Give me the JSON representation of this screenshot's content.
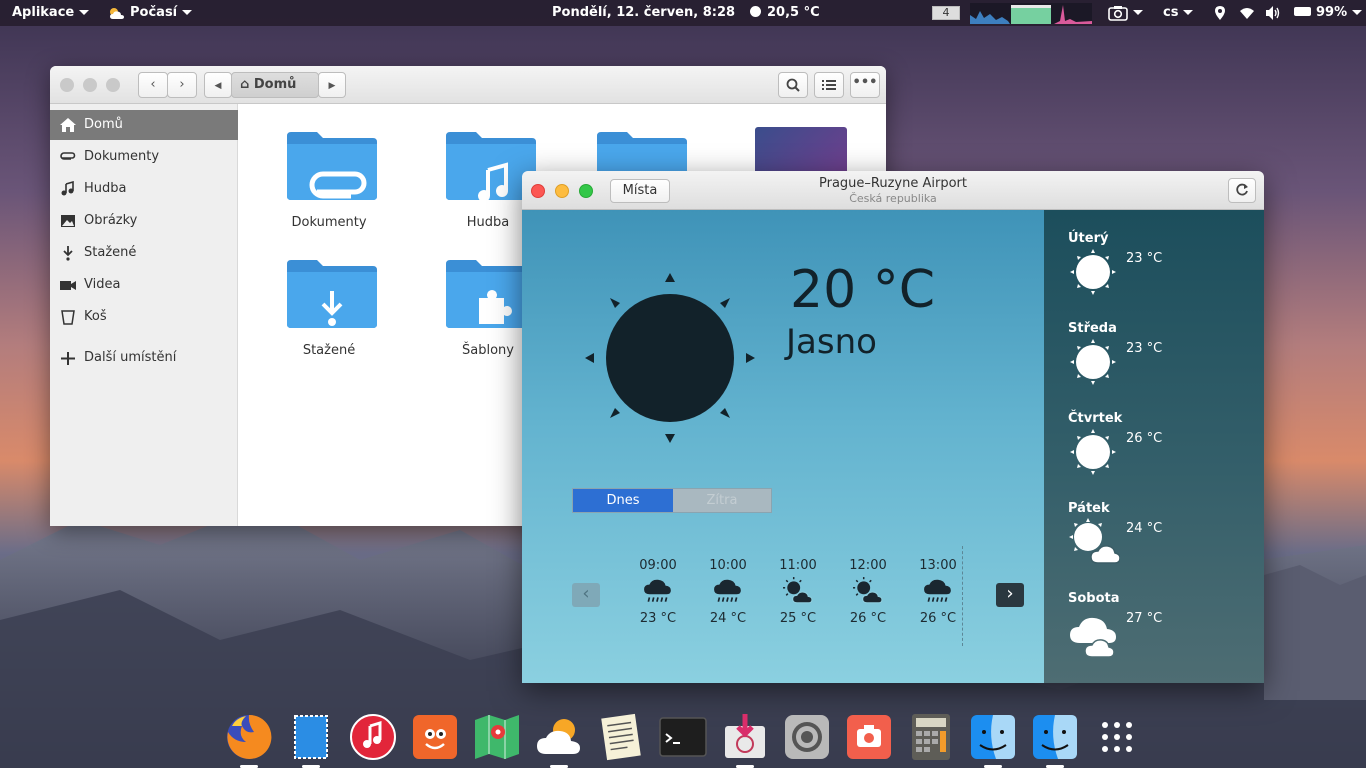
{
  "topbar": {
    "apps_label": "Aplikace",
    "weather_label": "Počasí",
    "datetime": "Pondělí, 12. červen,  8:28",
    "temperature": "20,5 °C",
    "workspace": "4",
    "language": "cs",
    "battery": "99%"
  },
  "files": {
    "location": "Domů",
    "sidebar": [
      {
        "label": "Domů",
        "icon": "home-icon"
      },
      {
        "label": "Dokumenty",
        "icon": "paperclip-icon"
      },
      {
        "label": "Hudba",
        "icon": "music-note-icon"
      },
      {
        "label": "Obrázky",
        "icon": "image-icon"
      },
      {
        "label": "Stažené",
        "icon": "download-icon"
      },
      {
        "label": "Videa",
        "icon": "video-camera-icon"
      },
      {
        "label": "Koš",
        "icon": "trash-icon"
      },
      {
        "label": "Další umístění",
        "icon": "plus-icon"
      }
    ],
    "folders": [
      {
        "label": "Dokumenty",
        "icon": "paperclip-icon"
      },
      {
        "label": "Hudba",
        "icon": "music-note-icon"
      },
      {
        "label": "Stažené",
        "icon": "download-icon"
      },
      {
        "label": "Šablony",
        "icon": "puzzle-icon"
      }
    ]
  },
  "weather": {
    "places_button": "Místa",
    "location": "Prague–Ruzyne Airport",
    "country": "Česká republika",
    "temperature": "20 °C",
    "condition": "Jasno",
    "tabs": {
      "today": "Dnes",
      "tomorrow": "Zítra"
    },
    "hourly": [
      {
        "time": "09:00",
        "temp": "23 °C",
        "icon": "rain-cloud-icon"
      },
      {
        "time": "10:00",
        "temp": "24 °C",
        "icon": "rain-cloud-icon"
      },
      {
        "time": "11:00",
        "temp": "25 °C",
        "icon": "cloud-sun-icon"
      },
      {
        "time": "12:00",
        "temp": "26 °C",
        "icon": "cloud-sun-icon"
      },
      {
        "time": "13:00",
        "temp": "26 °C",
        "icon": "rain-cloud-icon"
      }
    ],
    "daily": [
      {
        "day": "Úterý",
        "temp": "23 °C",
        "icon": "sun-icon"
      },
      {
        "day": "Středa",
        "temp": "23 °C",
        "icon": "sun-icon"
      },
      {
        "day": "Čtvrtek",
        "temp": "26 °C",
        "icon": "sun-icon"
      },
      {
        "day": "Pátek",
        "temp": "24 °C",
        "icon": "sun-cloud-icon"
      },
      {
        "day": "Sobota",
        "temp": "27 °C",
        "icon": "clouds-icon"
      }
    ]
  },
  "dock": [
    {
      "icon": "firefox-icon",
      "running": true
    },
    {
      "icon": "mail-icon",
      "running": true
    },
    {
      "icon": "music-player-icon",
      "running": false
    },
    {
      "icon": "gimp-icon",
      "running": false
    },
    {
      "icon": "maps-icon",
      "running": false
    },
    {
      "icon": "weather-app-icon",
      "running": true
    },
    {
      "icon": "text-editor-icon",
      "running": false
    },
    {
      "icon": "terminal-icon",
      "running": false
    },
    {
      "icon": "software-install-icon",
      "running": true
    },
    {
      "icon": "settings-icon",
      "running": false
    },
    {
      "icon": "screenshot-icon",
      "running": false
    },
    {
      "icon": "calculator-icon",
      "running": false
    },
    {
      "icon": "finder-icon",
      "running": true
    },
    {
      "icon": "finder-icon",
      "running": true
    },
    {
      "icon": "app-grid-icon",
      "running": false
    }
  ]
}
